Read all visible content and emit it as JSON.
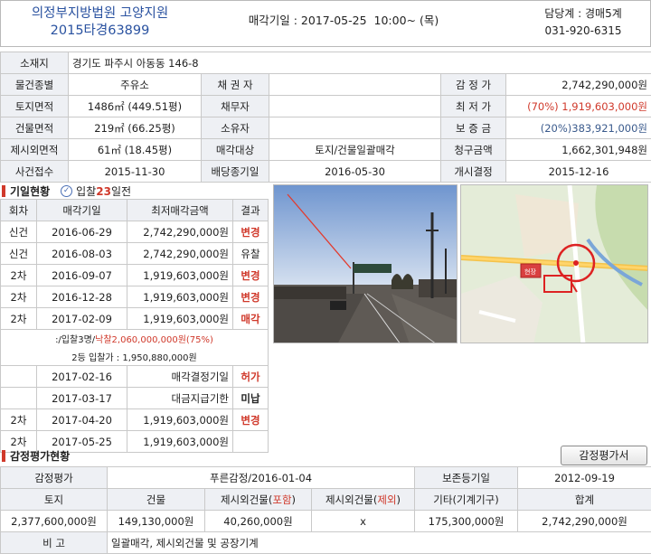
{
  "header": {
    "court": "의정부지방법원 고양지원",
    "case_no": "2015타경63899",
    "auction_date": "매각기일 : 2017-05-25  10:00~ (목)",
    "dept": "담당계 : 경매5계",
    "phone": "031-920-6315"
  },
  "info": {
    "address_label": "소재지",
    "address": "경기도 파주시 아동동 146-8",
    "type_label": "물건종별",
    "type": "주유소",
    "creditor_label": "채 권 자",
    "creditor": "",
    "appraisal_label": "감 정 가",
    "appraisal": "2,742,290,000원",
    "land_label": "토지면적",
    "land": "1486㎡ (449.51평)",
    "debtor_label": "채무자",
    "debtor": "",
    "min_label": "최 저 가",
    "min_pct": "(70%)",
    "min": "1,919,603,000원",
    "building_label": "건물면적",
    "building": "219㎡ (66.25평)",
    "owner_label": "소유자",
    "owner": "",
    "deposit_label": "보 증 금",
    "deposit": "(20%)383,921,000원",
    "excl_label": "제시외면적",
    "excl": "61㎡ (18.45평)",
    "target_label": "매각대상",
    "target": "토지/건물일괄매각",
    "claim_label": "청구금액",
    "claim": "1,662,301,948원",
    "filed_label": "사건접수",
    "filed": "2015-11-30",
    "dividend_label": "배당종기일",
    "dividend": "2016-05-30",
    "start_label": "개시결정",
    "start": "2015-12-16"
  },
  "history": {
    "title": "기일현황",
    "wait_prefix": "입찰",
    "wait_days": "23",
    "wait_suffix": "일전",
    "headers": [
      "회차",
      "매각기일",
      "최저매각금액",
      "결과"
    ],
    "rows": [
      {
        "round": "신건",
        "date": "2016-06-29",
        "amount": "2,742,290,000원",
        "result": "변경"
      },
      {
        "round": "신건",
        "date": "2016-08-03",
        "amount": "2,742,290,000원",
        "result": "유찰"
      },
      {
        "round": "2차",
        "date": "2016-09-07",
        "amount": "1,919,603,000원",
        "result": "변경"
      },
      {
        "round": "2차",
        "date": "2016-12-28",
        "amount": "1,919,603,000원",
        "result": "변경"
      },
      {
        "round": "2차",
        "date": "2017-02-09",
        "amount": "1,919,603,000원",
        "result": "매각"
      }
    ],
    "sale_line_a": ":/입찰3명/",
    "sale_line_b": "낙찰2,060,000,000원(75%)",
    "second_bid": "2등 입찰가 : 1,950,880,000원",
    "rows2": [
      {
        "round": "",
        "date": "2017-02-16",
        "amount": "매각결정기일",
        "result": "허가"
      },
      {
        "round": "",
        "date": "2017-03-17",
        "amount": "대금지급기한",
        "result": "미납"
      },
      {
        "round": "2차",
        "date": "2017-04-20",
        "amount": "1,919,603,000원",
        "result": "변경"
      },
      {
        "round": "2차",
        "date": "2017-05-25",
        "amount": "1,919,603,000원",
        "result": ""
      }
    ]
  },
  "map": {
    "label": "현장"
  },
  "eval": {
    "title": "감정평가현황",
    "button": "감정평가서",
    "r1": [
      "감정평가",
      "푸른감정/2016-01-04",
      "보존등기일",
      "2012-09-19"
    ],
    "headers": [
      "토지",
      "건물",
      "제시외건물(",
      "포함",
      ")",
      "제시외건물(",
      "제외",
      ")",
      "기타(기계기구)",
      "합계"
    ],
    "values": [
      "2,377,600,000원",
      "149,130,000원",
      "40,260,000원",
      "x",
      "175,300,000원",
      "2,742,290,000원"
    ],
    "note_label": "비 고",
    "note": "일괄매각, 제시외건물 및 공장기계"
  },
  "colors": {
    "accent_red": "#d0392b",
    "court_blue": "#2a52a0",
    "label_bg": "#eef0f4"
  }
}
